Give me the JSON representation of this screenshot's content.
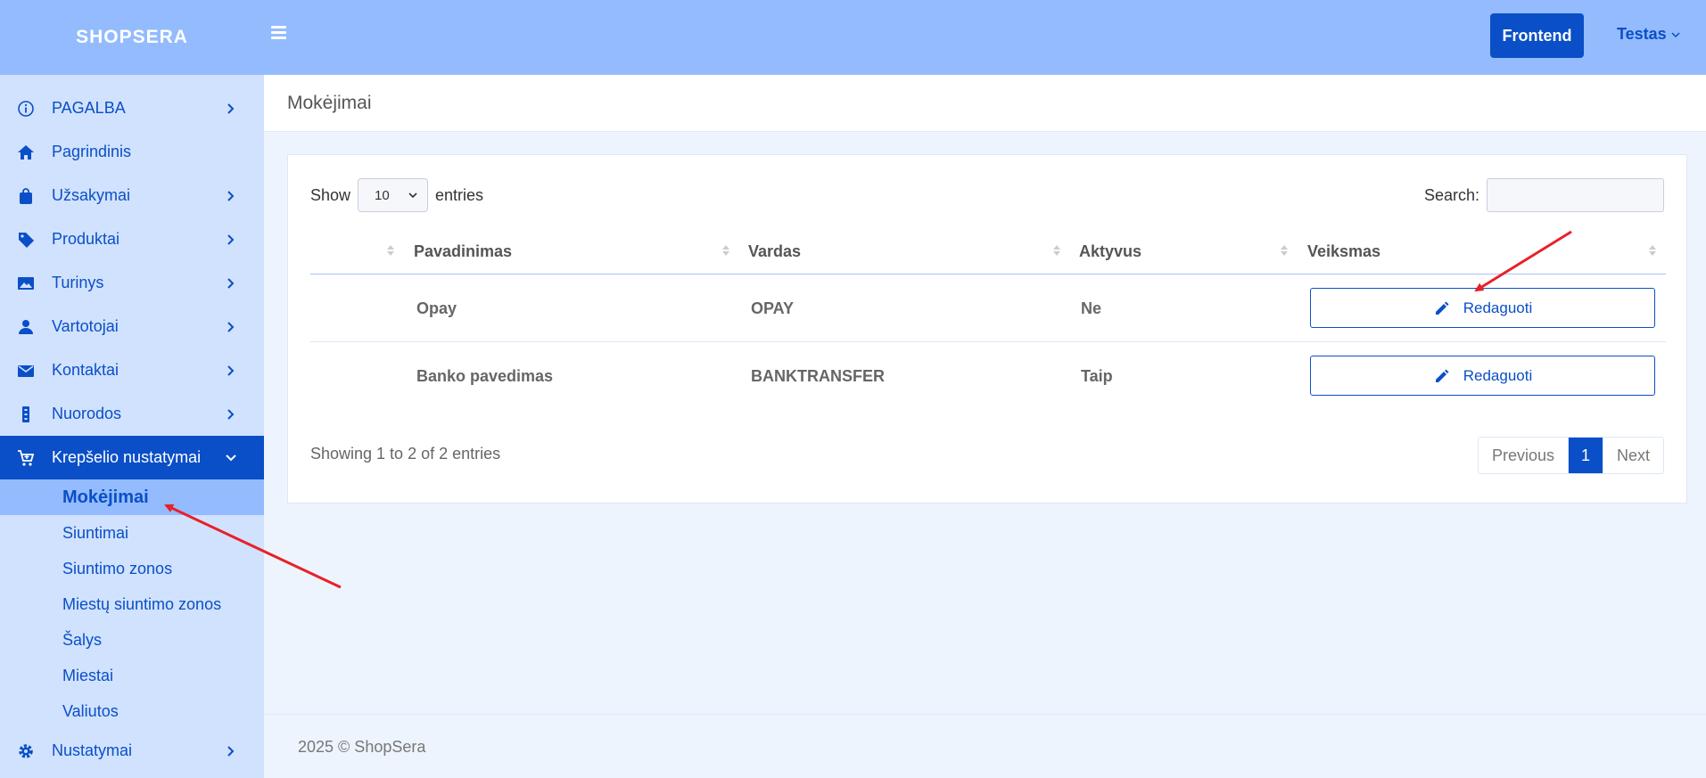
{
  "brand": "SHOPSERA",
  "topbar": {
    "frontend_label": "Frontend",
    "user_label": "Testas"
  },
  "sidebar": {
    "items": [
      {
        "label": "PAGALBA",
        "icon": "info-icon",
        "has_children": true
      },
      {
        "label": "Pagrindinis",
        "icon": "home-icon",
        "has_children": false
      },
      {
        "label": "Užsakymai",
        "icon": "bag-icon",
        "has_children": true
      },
      {
        "label": "Produktai",
        "icon": "tag-icon",
        "has_children": true
      },
      {
        "label": "Turinys",
        "icon": "image-icon",
        "has_children": true
      },
      {
        "label": "Vartotojai",
        "icon": "user-icon",
        "has_children": true
      },
      {
        "label": "Kontaktai",
        "icon": "mail-icon",
        "has_children": true
      },
      {
        "label": "Nuorodos",
        "icon": "link-icon",
        "has_children": true
      },
      {
        "label": "Krepšelio nustatymai",
        "icon": "cart-icon",
        "has_children": true,
        "expanded": true
      }
    ],
    "subitems": [
      {
        "label": "Mokėjimai",
        "active": true
      },
      {
        "label": "Siuntimai"
      },
      {
        "label": "Siuntimo zonos"
      },
      {
        "label": "Miestų siuntimo zonos"
      },
      {
        "label": "Šalys"
      },
      {
        "label": "Miestai"
      },
      {
        "label": "Valiutos"
      }
    ],
    "last_item": {
      "label": "Nustatymai",
      "icon": "gear-icon",
      "has_children": true
    }
  },
  "page": {
    "title": "Mokėjimai"
  },
  "table": {
    "show_label": "Show",
    "entries_label": "entries",
    "page_length": "10",
    "search_label": "Search:",
    "search_value": "",
    "columns": [
      "Pavadinimas",
      "Vardas",
      "Aktyvus",
      "Veiksmas"
    ],
    "rows": [
      {
        "pavadinimas": "Opay",
        "vardas": "OPAY",
        "aktyvus": "Ne",
        "action": "Redaguoti"
      },
      {
        "pavadinimas": "Banko pavedimas",
        "vardas": "BANKTRANSFER",
        "aktyvus": "Taip",
        "action": "Redaguoti"
      }
    ],
    "info": "Showing 1 to 2 of 2 entries",
    "pagination": {
      "previous": "Previous",
      "current": "1",
      "next": "Next"
    }
  },
  "footer": "2025 © ShopSera",
  "colors": {
    "topbar": "#93bbfe",
    "sidebar": "#d1e2fe",
    "accent": "#0a4fc7",
    "annotation": "#e8202a"
  }
}
